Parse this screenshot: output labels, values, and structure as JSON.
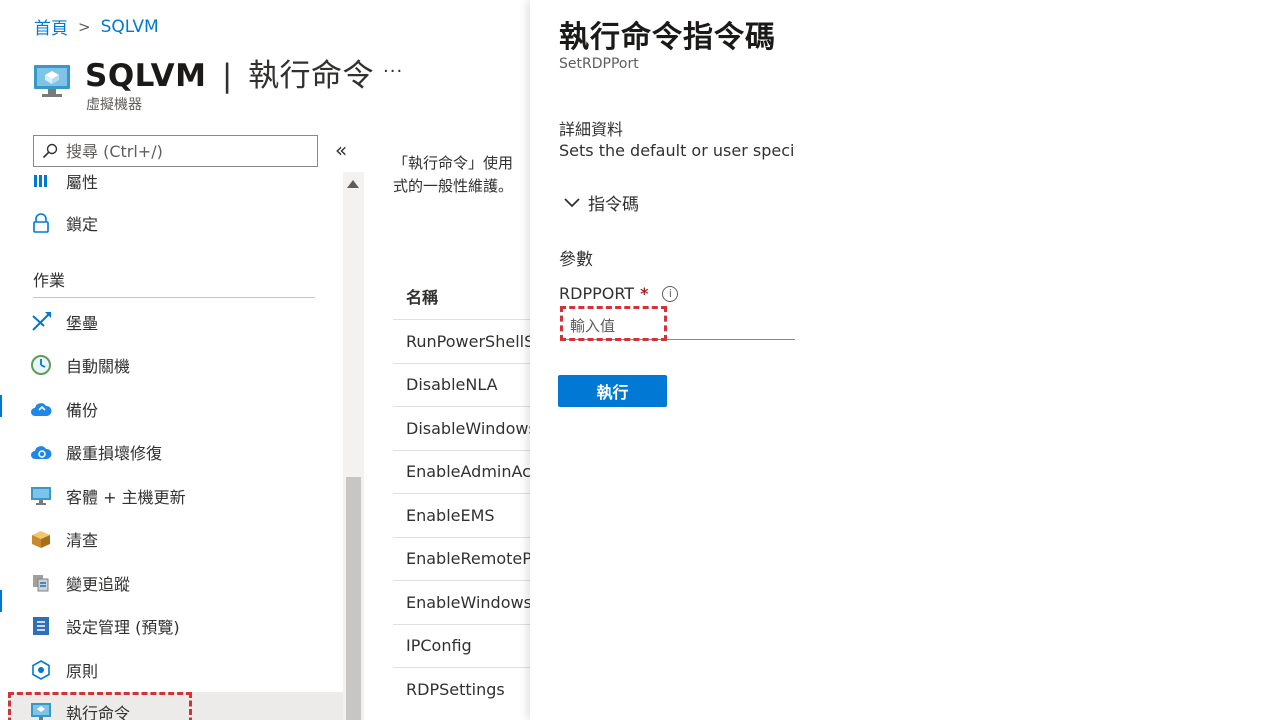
{
  "breadcrumb": {
    "home": "首頁",
    "current": "SQLVM"
  },
  "header": {
    "title": "SQLVM",
    "separator": "|",
    "subtitle_action": "執行命令",
    "more": "...",
    "resource_type": "虛擬機器"
  },
  "search": {
    "placeholder": "搜尋 (Ctrl+/)",
    "collapse": "«"
  },
  "sidebar": {
    "items_top": [
      {
        "label": "屬性",
        "icon": "properties-icon"
      },
      {
        "label": "鎖定",
        "icon": "lock-icon"
      }
    ],
    "section": "作業",
    "items": [
      {
        "label": "堡壘",
        "icon": "bastion-icon"
      },
      {
        "label": "自動關機",
        "icon": "clock-icon"
      },
      {
        "label": "備份",
        "icon": "cloud-backup-icon"
      },
      {
        "label": "嚴重損壞修復",
        "icon": "cloud-recovery-icon"
      },
      {
        "label": "客體 + 主機更新",
        "icon": "monitor-update-icon"
      },
      {
        "label": "清查",
        "icon": "inventory-box-icon"
      },
      {
        "label": "變更追蹤",
        "icon": "change-tracking-icon"
      },
      {
        "label": "設定管理 (預覽)",
        "icon": "config-management-icon"
      },
      {
        "label": "原則",
        "icon": "policy-icon"
      },
      {
        "label": "執行命令",
        "icon": "run-command-icon"
      }
    ]
  },
  "content": {
    "description_line1": "「執行命令」使用",
    "description_line2": "式的一般性維護。",
    "column_name": "名稱",
    "commands": [
      "RunPowerShellScript",
      "DisableNLA",
      "DisableWindowsUpdate",
      "EnableAdminAccount",
      "EnableEMS",
      "EnableRemotePS",
      "EnableWindowsUpdate",
      "IPConfig",
      "RDPSettings"
    ]
  },
  "blade": {
    "title": "執行命令指令碼",
    "subtitle": "SetRDPPort",
    "details_label": "詳細資料",
    "details_text": "Sets the default or user specified",
    "script_toggle": "指令碼",
    "params_label": "參數",
    "rdp_port_label": "RDPPORT",
    "required_marker": "*",
    "info_icon": "i",
    "input_placeholder": "輸入值",
    "run_button": "執行"
  },
  "colors": {
    "accent": "#0078d4",
    "highlight_dash": "#d13438",
    "active_item_bg": "#edebe9"
  }
}
